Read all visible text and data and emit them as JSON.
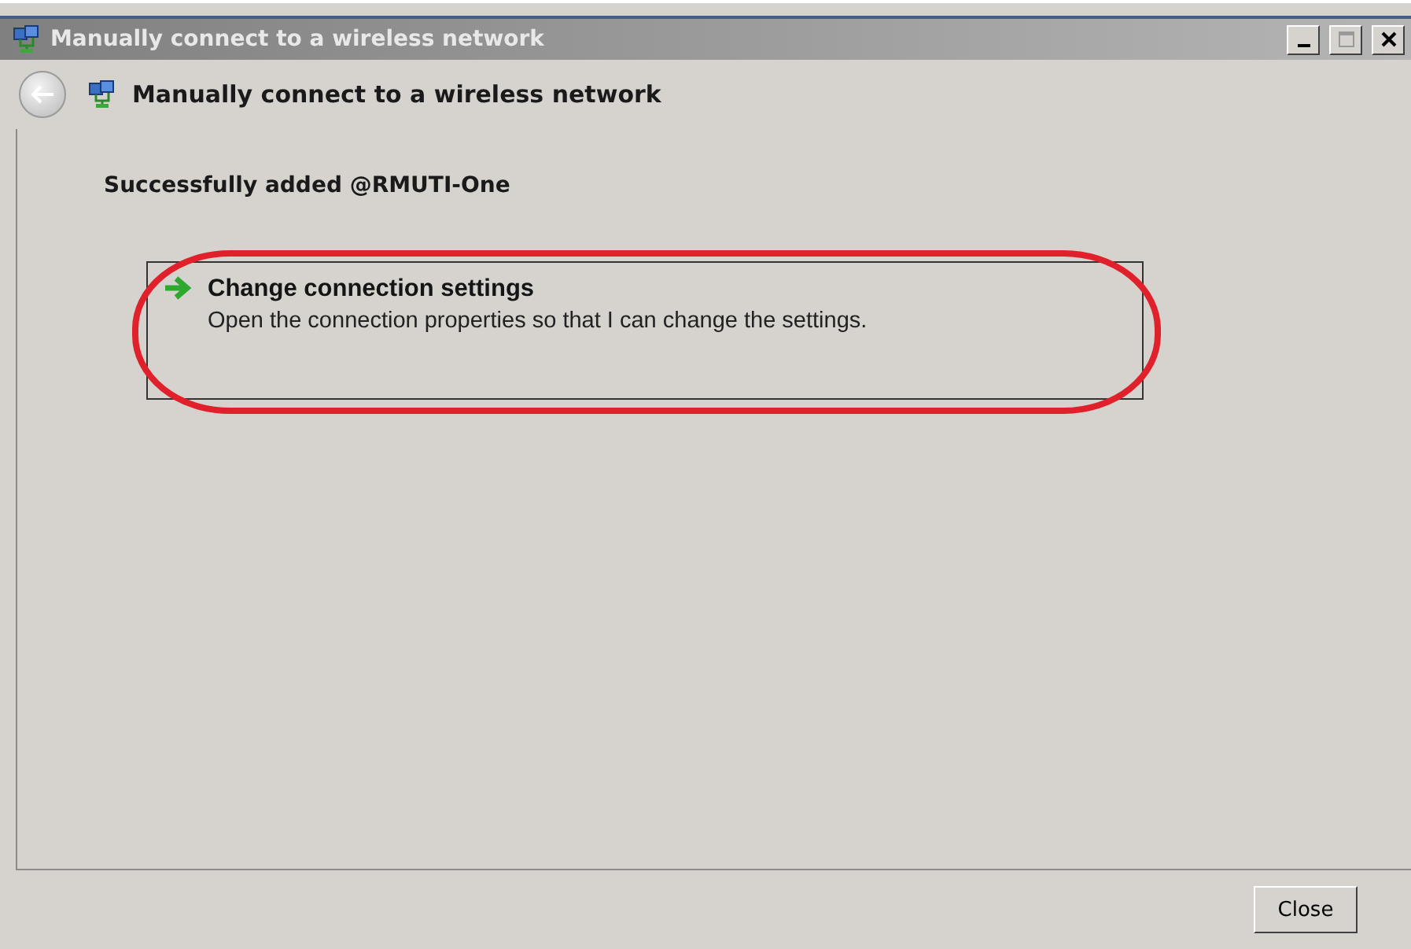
{
  "window": {
    "title": "Manually connect to a wireless network",
    "controls": [
      {
        "kind": "minimize"
      },
      {
        "kind": "maximize"
      },
      {
        "kind": "close"
      }
    ]
  },
  "header": {
    "title": "Manually connect to a wireless network"
  },
  "message": "Successfully added @RMUTI-One",
  "option": {
    "title": "Change connection settings",
    "description": "Open the connection properties so that I can change the settings.",
    "highlighted": true
  },
  "buttons": [
    "Close"
  ]
}
